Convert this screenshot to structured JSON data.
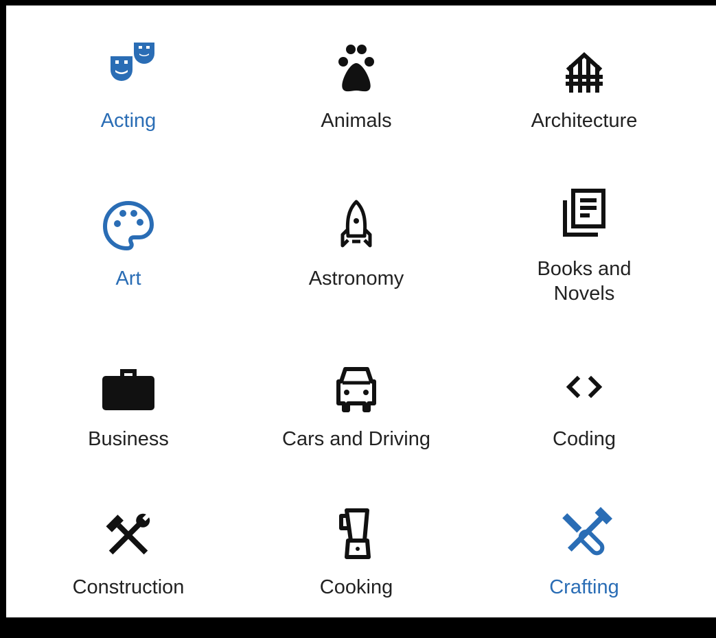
{
  "categories": [
    {
      "label": "Acting",
      "icon": "theater-masks-icon",
      "selected": true
    },
    {
      "label": "Animals",
      "icon": "paw-icon",
      "selected": false
    },
    {
      "label": "Architecture",
      "icon": "gazebo-icon",
      "selected": false
    },
    {
      "label": "Art",
      "icon": "palette-icon",
      "selected": true
    },
    {
      "label": "Astronomy",
      "icon": "rocket-icon",
      "selected": false
    },
    {
      "label": "Books and Novels",
      "label_lines": [
        "Books and",
        "Novels"
      ],
      "icon": "books-icon",
      "selected": false
    },
    {
      "label": "Business",
      "icon": "briefcase-icon",
      "selected": false
    },
    {
      "label": "Cars and Driving",
      "icon": "car-icon",
      "selected": false
    },
    {
      "label": "Coding",
      "icon": "code-icon",
      "selected": false
    },
    {
      "label": "Construction",
      "icon": "hammer-wrench-icon",
      "selected": false
    },
    {
      "label": "Cooking",
      "icon": "blender-icon",
      "selected": false
    },
    {
      "label": "Crafting",
      "icon": "crafting-tools-icon",
      "selected": true
    }
  ],
  "colors": {
    "selected": "#2a6db5",
    "default_icon": "#111111",
    "default_text": "#222222",
    "background": "#ffffff",
    "frame": "#000000"
  }
}
